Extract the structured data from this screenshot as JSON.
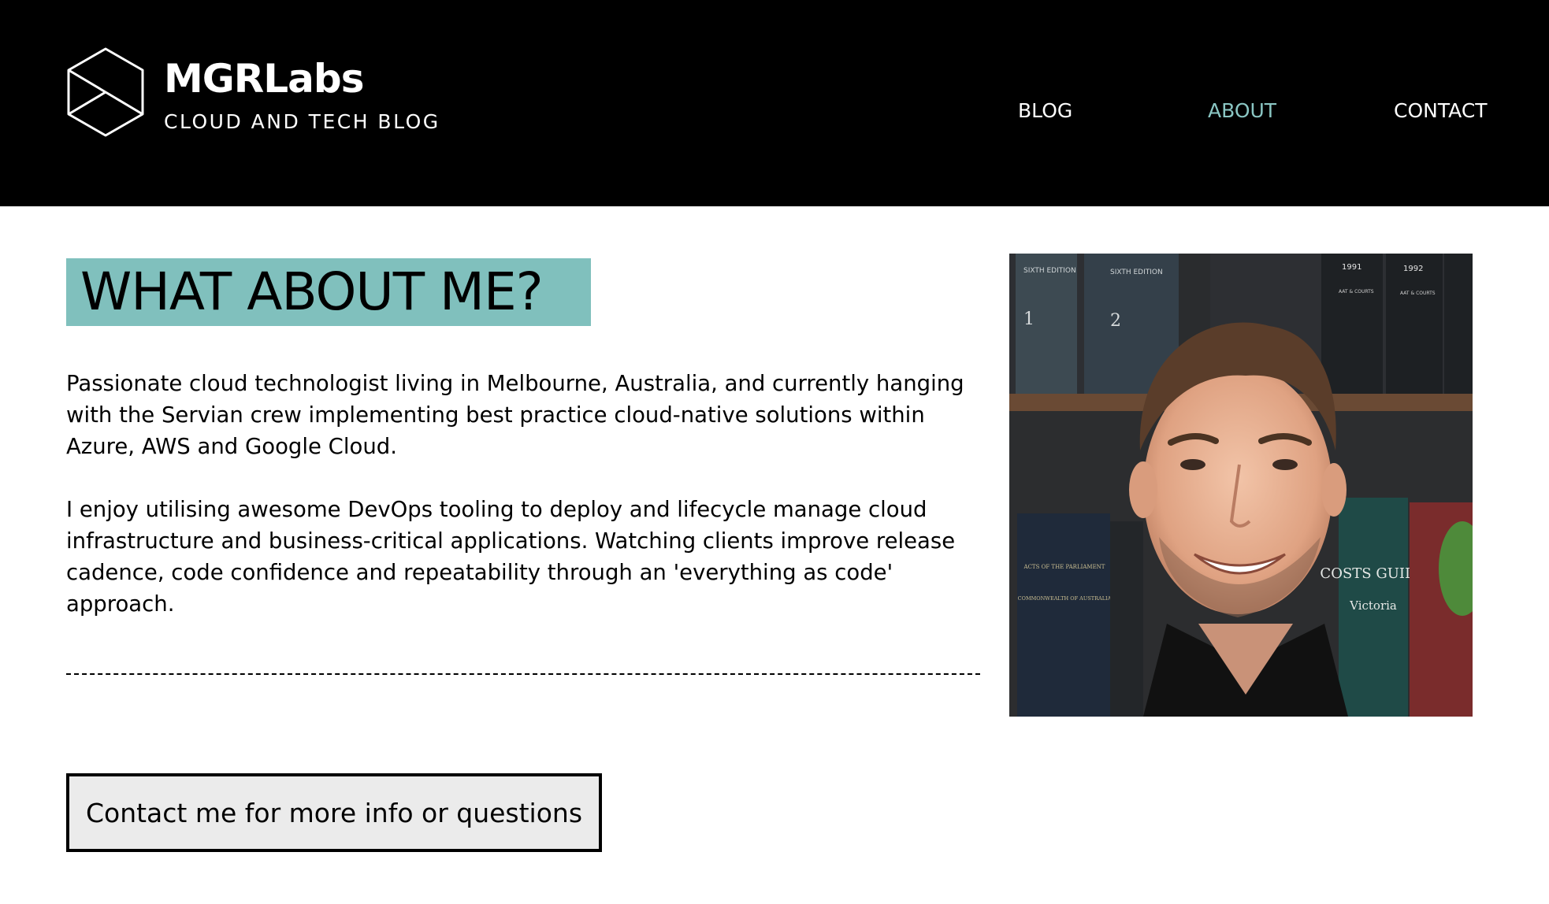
{
  "header": {
    "brand": "MGRLabs",
    "tagline": "CLOUD AND TECH BLOG",
    "logo_icon": "hexagon-cube-icon",
    "nav": [
      {
        "label": "BLOG",
        "active": false
      },
      {
        "label": "ABOUT",
        "active": true
      },
      {
        "label": "CONTACT",
        "active": false
      }
    ]
  },
  "main": {
    "heading": "WHAT ABOUT ME?",
    "paragraphs": [
      "Passionate cloud technologist living in Melbourne, Australia, and currently hanging with the Servian crew implementing best practice cloud-native solutions within Azure, AWS and Google Cloud.",
      "I enjoy utilising awesome DevOps tooling to deploy and lifecycle manage cloud infrastructure and business-critical applications. Watching clients improve release cadence, code confidence and repeatability through an 'everything as code' approach."
    ],
    "contact_button": "Contact me for more info or questions"
  },
  "photo": {
    "book_spines": [
      "SIXTH EDITION",
      "1",
      "SIXTH EDITION",
      "2",
      "1991",
      "AAT & COURTS",
      "1992",
      "AAT & COURTS",
      "ACTS OF THE PARLIAMENT",
      "COMMONWEALTH OF AUSTRALIA",
      "COSTS GUIDE",
      "Victoria"
    ]
  },
  "colors": {
    "header_bg": "#000000",
    "accent": "#80c0bd",
    "active_nav": "#8ac6c3",
    "button_bg": "#ebebeb"
  }
}
